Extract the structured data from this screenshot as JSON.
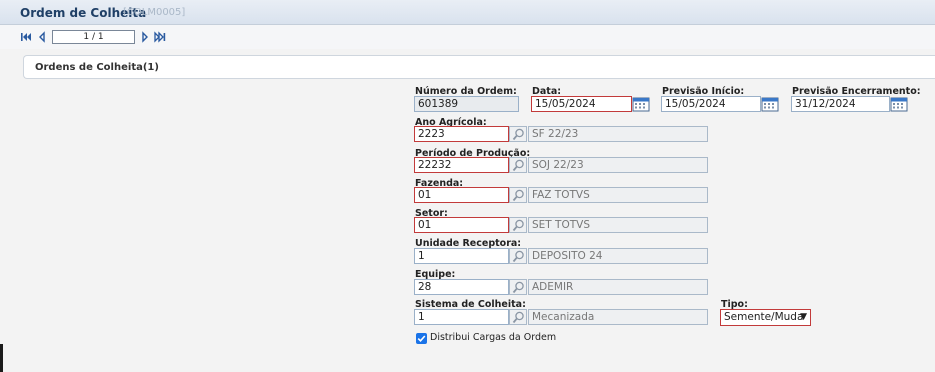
{
  "header": {
    "title": "Ordem de Colheita",
    "code": "[COLM0005]"
  },
  "pager": {
    "value": "1 / 1"
  },
  "panel": {
    "title": "Ordens de Colheita(1)"
  },
  "form": {
    "numero_ordem": {
      "label": "Número da Ordem:",
      "value": "601389"
    },
    "data": {
      "label": "Data:",
      "value": "15/05/2024"
    },
    "previsao_inicio": {
      "label": "Previsão Início:",
      "value": "15/05/2024"
    },
    "previsao_encerramento": {
      "label": "Previsão Encerramento:",
      "value": "31/12/2024"
    },
    "ano_agricola": {
      "label": "Ano Agrícola:",
      "value": "2223",
      "desc": "SF 22/23"
    },
    "periodo_producao": {
      "label": "Período de Produção:",
      "value": "22232",
      "desc": "SOJ 22/23"
    },
    "fazenda": {
      "label": "Fazenda:",
      "value": "01",
      "desc": "FAZ TOTVS"
    },
    "setor": {
      "label": "Setor:",
      "value": "01",
      "desc": "SET TOTVS"
    },
    "unidade_receptora": {
      "label": "Unidade Receptora:",
      "value": "1",
      "desc": "DEPOSITO 24"
    },
    "equipe": {
      "label": "Equipe:",
      "value": "28",
      "desc": "ADEMIR"
    },
    "sistema_colheita": {
      "label": "Sistema de Colheita:",
      "value": "1",
      "desc": "Mecanizada"
    },
    "tipo": {
      "label": "Tipo:",
      "value": "Semente/Muda"
    },
    "distribui_cargas": {
      "label": "Distribui Cargas da Ordem",
      "checked": true
    }
  },
  "colors": {
    "required_border": "#c23a3a",
    "title": "#1f3f66",
    "checkbox": "#1a73e8"
  },
  "icons": [
    "first-page-icon",
    "prev-page-icon",
    "next-page-icon",
    "last-page-icon",
    "search-icon",
    "calendar-icon",
    "checkmark-icon"
  ]
}
